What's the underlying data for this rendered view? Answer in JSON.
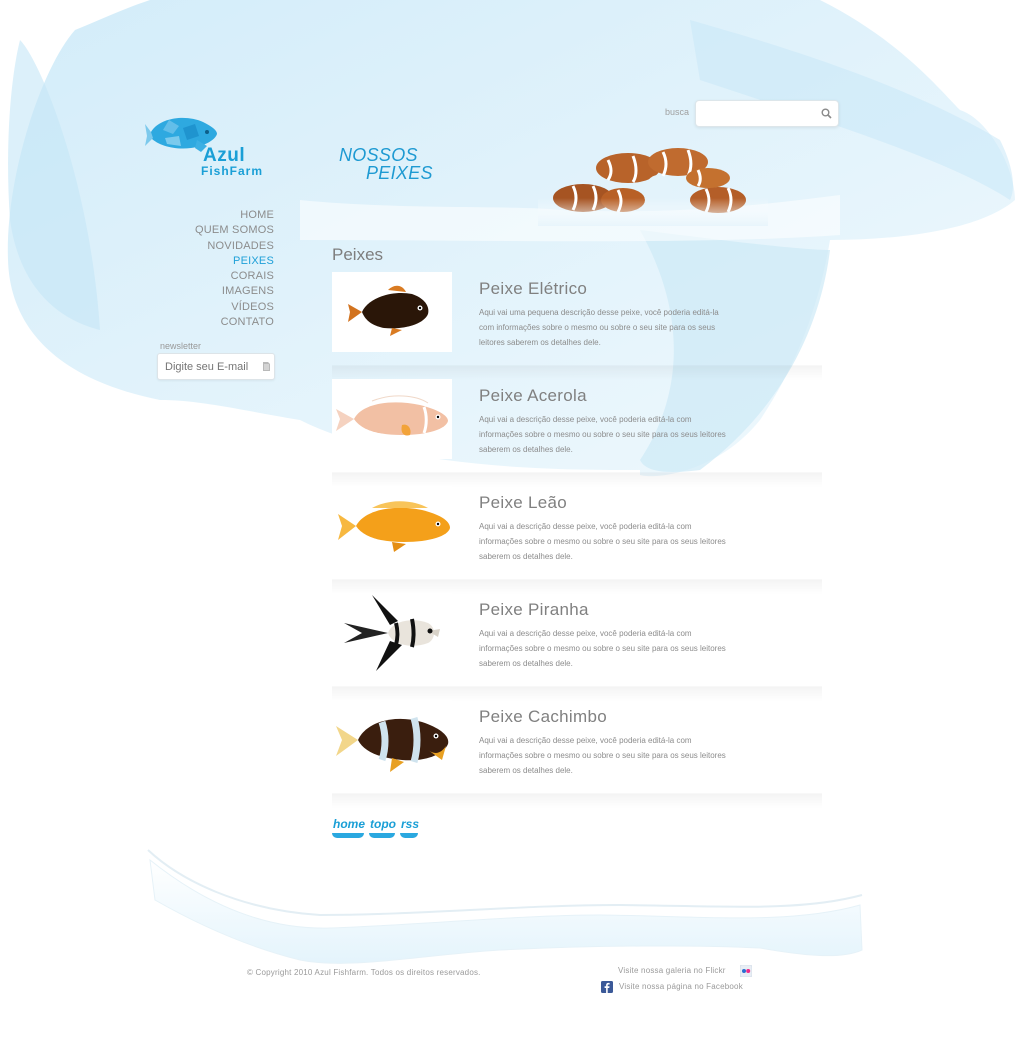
{
  "brand": {
    "name_1": "Azul",
    "name_2a": "Fish",
    "name_2b": "Farm"
  },
  "nav": {
    "items": [
      {
        "label": "HOME"
      },
      {
        "label": "QUEM SOMOS"
      },
      {
        "label": "NOVIDADES"
      },
      {
        "label": "PEIXES",
        "active": true
      },
      {
        "label": "CORAIS"
      },
      {
        "label": "IMAGENS"
      },
      {
        "label": "VÍDEOS"
      },
      {
        "label": "CONTATO"
      }
    ]
  },
  "newsletter": {
    "label": "newsletter",
    "placeholder": "Digite seu E-mail"
  },
  "search": {
    "label": "busca",
    "placeholder": ""
  },
  "heading": {
    "line1": "NOSSOS",
    "line2": "PEIXES"
  },
  "section_title": "Peixes",
  "fishes": [
    {
      "name": "Peixe Elétrico",
      "description": "Aqui vai uma pequena descrição desse peixe, você poderia editá-la com informações sobre o mesmo ou sobre o seu site para os seus leitores saberem os detalhes dele."
    },
    {
      "name": "Peixe Acerola",
      "description": "Aqui vai a descrição desse peixe, você poderia editá-la com informações sobre o mesmo ou sobre o seu site para os seus leitores saberem os detalhes dele."
    },
    {
      "name": "Peixe Leão",
      "description": "Aqui vai a descrição desse peixe, você poderia editá-la com informações sobre o mesmo ou sobre o seu site para os seus leitores saberem os detalhes dele."
    },
    {
      "name": "Peixe Piranha",
      "description": "Aqui vai a descrição desse peixe, você poderia editá-la com informações sobre o mesmo ou sobre o seu site para os seus leitores saberem os detalhes dele."
    },
    {
      "name": "Peixe Cachimbo",
      "description": "Aqui vai a descrição desse peixe, você poderia editá-la com informações sobre o mesmo ou sobre o seu site para os seus leitores saberem os detalhes dele."
    }
  ],
  "footer_links": {
    "home": "home",
    "topo": "topo",
    "rss": "rss"
  },
  "copyright": "© Copyright 2010 Azul Fishfarm. Todos os direitos reservados.",
  "social": {
    "flickr": "Visite nossa galeria no Flickr",
    "facebook": "Visite nossa página no Facebook"
  },
  "colors": {
    "accent": "#1fa0d8",
    "text": "#8a8a8a",
    "water": "#d6eef9"
  },
  "icons": {
    "search": "search-icon",
    "newsletter": "document-icon",
    "flickr": "flickr-icon",
    "facebook": "facebook-icon"
  }
}
